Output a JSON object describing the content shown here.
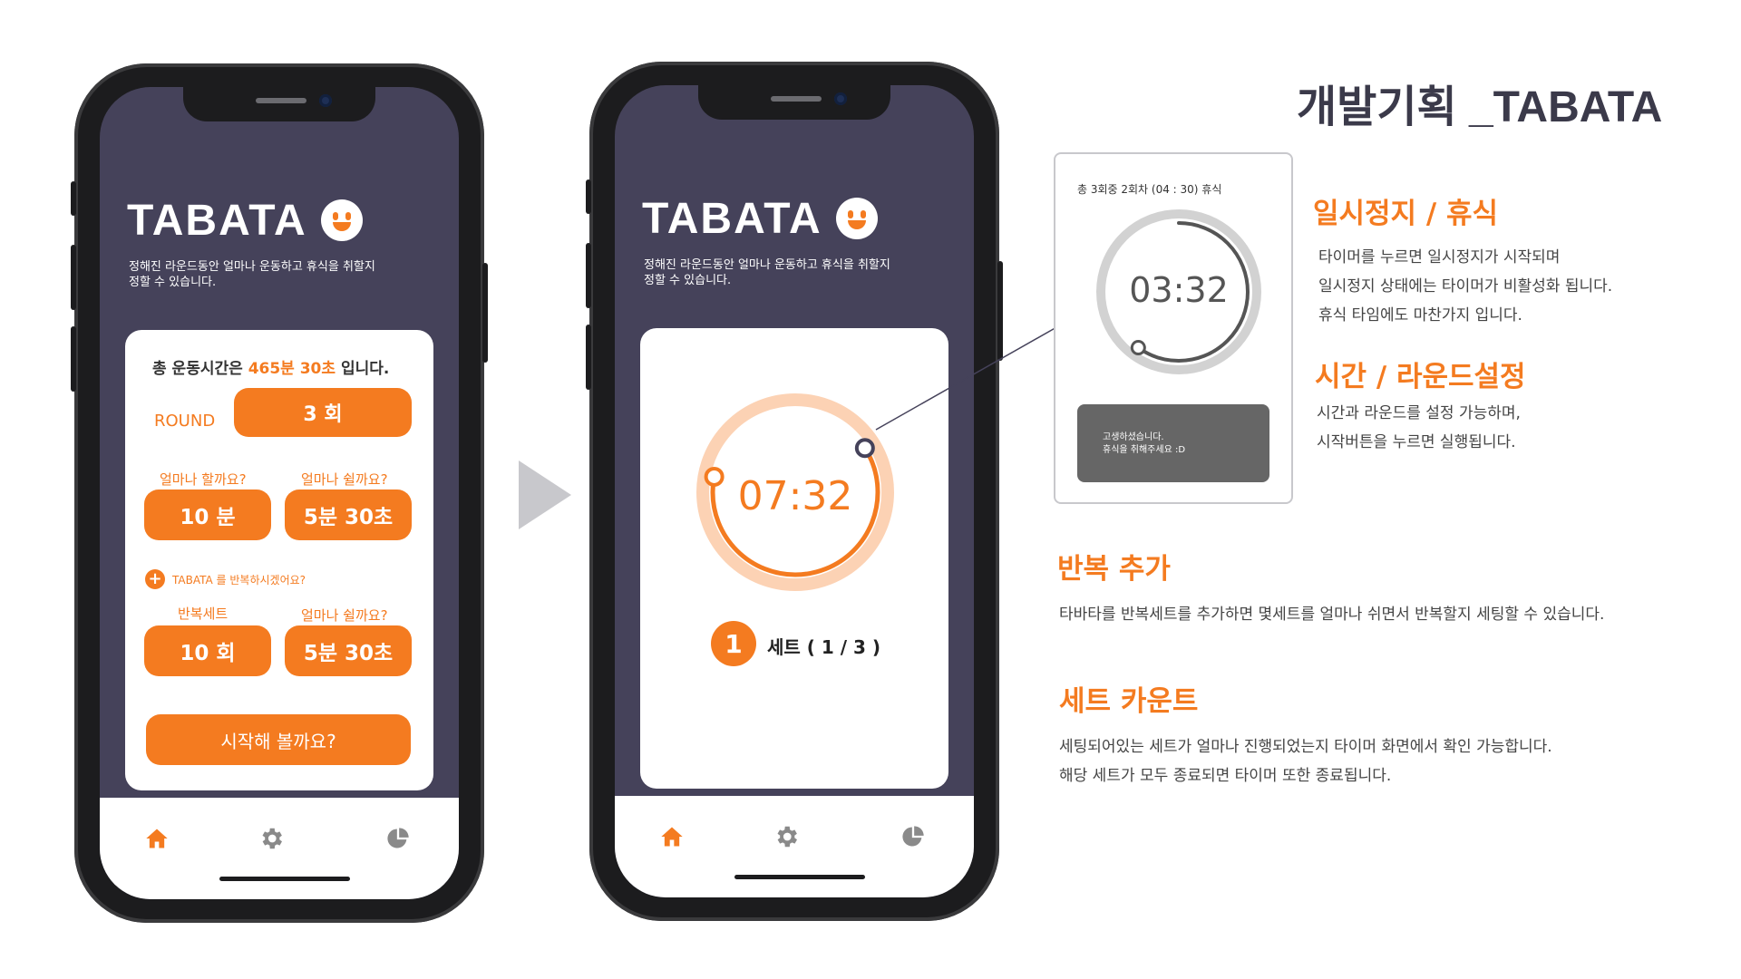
{
  "page": {
    "title": "개발기획 _TABATA"
  },
  "colors": {
    "accent": "#f47b20",
    "screen_bg": "#45425a",
    "frame": "#1c1c1e"
  },
  "phone1": {
    "app_title": "TABATA",
    "description_line1": "정해진 라운드동안 얼마나 운동하고 휴식을 취할지",
    "description_line2": "정할 수 있습니다.",
    "total_prefix": "총 운동시간은 ",
    "total_value": "465분 30초",
    "total_suffix": " 입니다.",
    "round_label": "ROUND",
    "round_value": "3 회",
    "work_label": "얼마나 할까요?",
    "work_value": "10 분",
    "rest_label": "얼마나 쉴까요?",
    "rest_value": "5분 30초",
    "repeat_prompt": "TABATA 를 반복하시겠어요?",
    "repeat_set_label": "반복세트",
    "repeat_set_value": "10 회",
    "repeat_rest_label": "얼마나 쉴까요?",
    "repeat_rest_value": "5분 30초",
    "start_button": "시작해 볼까요?"
  },
  "phone2": {
    "app_title": "TABATA",
    "description_line1": "정해진 라운드동안 얼마나 운동하고 휴식을 취할지",
    "description_line2": "정할 수 있습니다.",
    "timer": "07:32",
    "set_number": "1",
    "set_label": "세트 ( 1 / 3 )"
  },
  "zoom_card": {
    "header": "총 3회중 2회차 (04 : 30) 휴식",
    "timer": "03:32",
    "message_line1": "고생하셨습니다.",
    "message_line2": "휴식을 취해주세요 :D"
  },
  "sections": {
    "pause": {
      "title": "일시정지 / 휴식",
      "lines": [
        "타이머를 누르면 일시정지가 시작되며",
        "일시정지 상태에는 타이머가 비활성화 됩니다.",
        "휴식 타임에도 마찬가지 입니다."
      ]
    },
    "time": {
      "title": "시간 / 라운드설정",
      "lines": [
        "시간과 라운드를 설정 가능하며,",
        "시작버튼을 누르면 실행됩니다."
      ]
    },
    "repeat": {
      "title": "반복 추가",
      "lines": [
        "타바타를 반복세트를 추가하면 몇세트를 얼마나 쉬면서 반복할지 세팅할 수 있습니다."
      ]
    },
    "count": {
      "title": "세트 카운트",
      "lines": [
        "세팅되어있는 세트가 얼마나 진행되었는지 타이머 화면에서 확인 가능합니다.",
        "해당 세트가 모두 종료되면 타이머 또한 종료됩니다."
      ]
    }
  },
  "timer_progress": {
    "phone2_ring_fraction": 0.62,
    "zoom_ring_fraction": 0.6
  },
  "icons": [
    "home-icon",
    "gear-icon",
    "pie-chart-icon",
    "smiley-icon",
    "plus-circle-icon",
    "play-arrow-icon"
  ]
}
